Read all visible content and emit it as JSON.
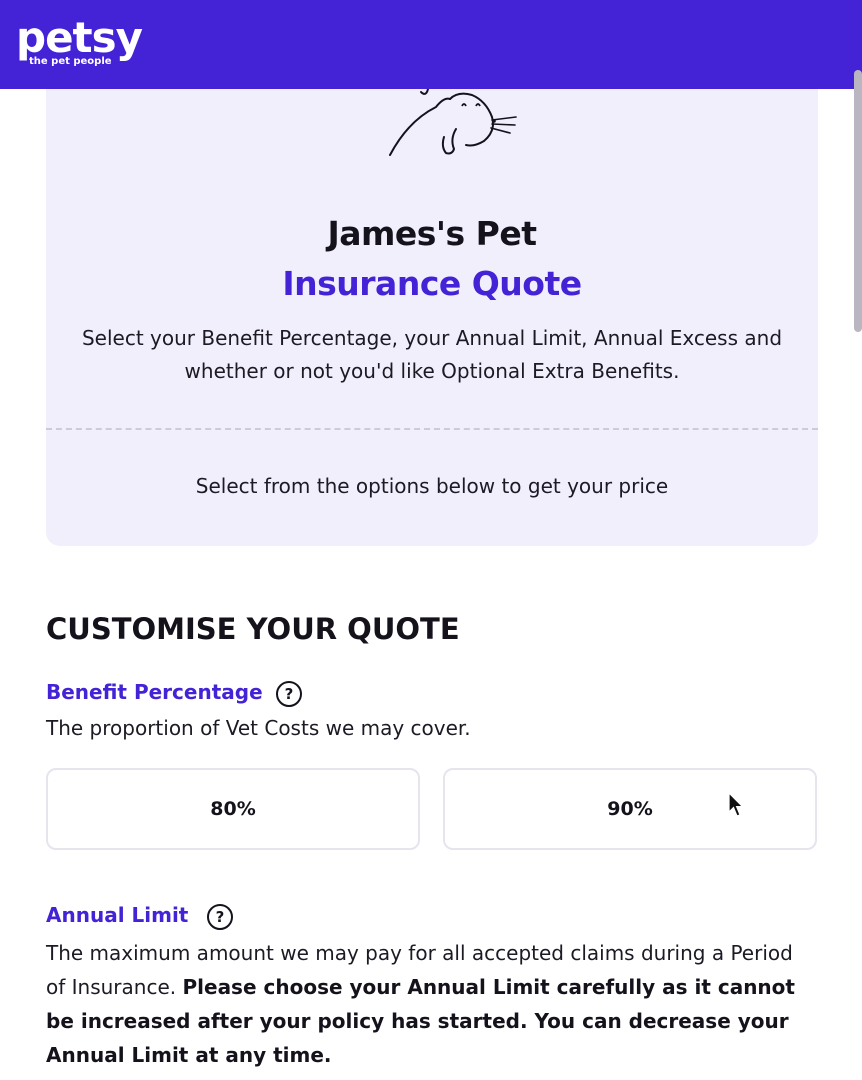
{
  "header": {
    "logo_text": "petsy",
    "tagline": "the pet people",
    "background": "#4423d6"
  },
  "quote_card": {
    "illustration": "cat-line-art-icon",
    "title_line1": "James's Pet",
    "title_line2": "Insurance Quote",
    "description": "Select your Benefit Percentage, your Annual Limit, Annual Excess and whether or not you'd like Optional Extra Benefits.",
    "instruction": "Select from the options below to get your price"
  },
  "customise": {
    "section_title": "CUSTOMISE YOUR QUOTE",
    "benefit_percentage": {
      "label": "Benefit Percentage",
      "help_icon": "?",
      "description": "The proportion of Vet Costs we may cover.",
      "options": [
        "80%",
        "90%"
      ]
    },
    "annual_limit": {
      "label": "Annual Limit",
      "help_icon": "?",
      "description_regular": "The maximum amount we may pay for all accepted claims during a Period of Insurance.",
      "description_bold": "Please choose your Annual Limit carefully as it cannot be increased after your policy has started. You can decrease your Annual Limit at any time."
    }
  },
  "colors": {
    "brand": "#4423d6",
    "card_background": "#f1effc",
    "text": "#1d1a24"
  }
}
